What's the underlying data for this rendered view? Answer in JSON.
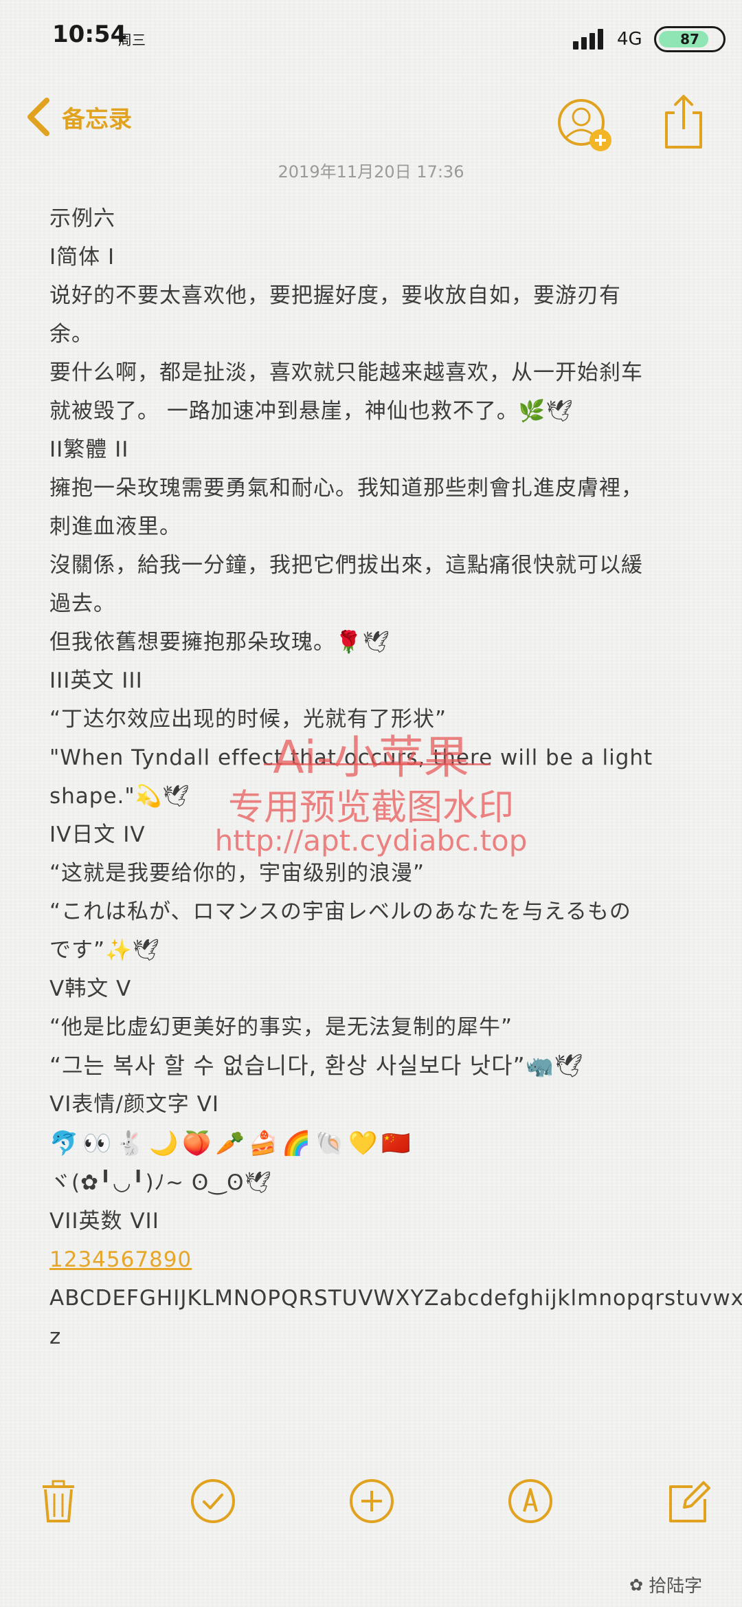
{
  "status": {
    "time": "10:54",
    "weekday": "周三",
    "network": "4G",
    "battery": "87"
  },
  "nav": {
    "back_label": "备忘录"
  },
  "note": {
    "date": "2019年11月20日 17:36",
    "lines": [
      "示例六",
      "I简体 I",
      "说好的不要太喜欢他，要把握好度，要收放自如，要游刃有",
      "余。",
      "要什么啊，都是扯淡，喜欢就只能越来越喜欢，从一开始刹车",
      "就被毁了。 一路加速冲到悬崖，神仙也救不了。🌿🕊",
      "II繁體 II",
      "擁抱一朵玫瑰需要勇氣和耐心。我知道那些刺會扎進皮膚裡，",
      "刺進血液里。",
      "沒關係，給我一分鐘，我把它們拔出來，這點痛很快就可以緩",
      "過去。",
      "但我依舊想要擁抱那朵玫瑰。🌹🕊",
      "III英文 III",
      "“丁达尔效应出现的时候，光就有了形状”",
      "\"When Tyndall effect that occurs, there will be a light",
      "shape.\"💫🕊",
      "IV日文 IV",
      "“这就是我要给你的，宇宙级别的浪漫”",
      "“これは私が、ロマンスの宇宙レベルのあなたを与えるもの",
      "です”✨🕊",
      "V韩文 V",
      "“他是比虚幻更美好的事实，是无法复制的犀牛”",
      "“그는 복사 할 수 없습니다, 환상 사실보다 낫다”🦏🕊",
      "VI表情/颜文字 VI",
      "🐬👀🐇🌙🍑🥕🍰🌈🐚💛🇨🇳",
      "ヾ(✿╹◡╹)ﾉ~     ʘ‿ʘ🕊",
      "VII英数 VII",
      "1234567890",
      "ABCDEFGHIJKLMNOPQRSTUVWXYZabcdefghijklmnopqrstuvwxy",
      "z"
    ]
  },
  "watermark": {
    "line1": "Ai-小苹果",
    "line2": "专用预览截图水印",
    "line3": "http://apt.cydiabc.top"
  },
  "footer": {
    "wechat_label": "拾陆字"
  },
  "icons": {
    "back": "chevron-left-icon",
    "add_person": "add-person-icon",
    "share": "share-icon",
    "delete": "trash-icon",
    "checklist": "checkmark-circle-icon",
    "add": "plus-circle-icon",
    "draw": "pen-circle-icon",
    "compose": "compose-icon"
  },
  "colors": {
    "accent": "#e0a21f",
    "watermark": "#e85656",
    "text": "#3c3c3c"
  }
}
